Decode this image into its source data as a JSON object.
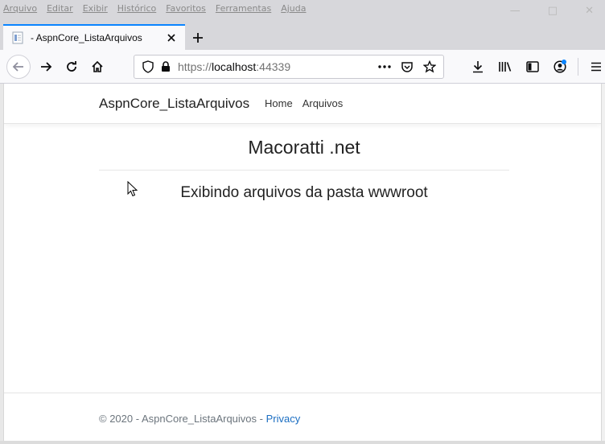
{
  "window": {
    "menu": [
      "Arquivo",
      "Editar",
      "Exibir",
      "Histórico",
      "Favoritos",
      "Ferramentas",
      "Ajuda"
    ]
  },
  "tab": {
    "title": "- AspnCore_ListaArquivos"
  },
  "urlbar": {
    "scheme": "https://",
    "host": "localhost",
    "port": ":44339"
  },
  "site": {
    "brand": "AspnCore_ListaArquivos",
    "nav": [
      "Home",
      "Arquivos"
    ],
    "title": "Macoratti .net",
    "subtitle": "Exibindo arquivos da pasta wwwroot",
    "footer_text": "© 2020 - AspnCore_ListaArquivos - ",
    "footer_link": "Privacy"
  },
  "colors": {
    "accent": "#0a84ff",
    "link": "#1b6ec2"
  }
}
